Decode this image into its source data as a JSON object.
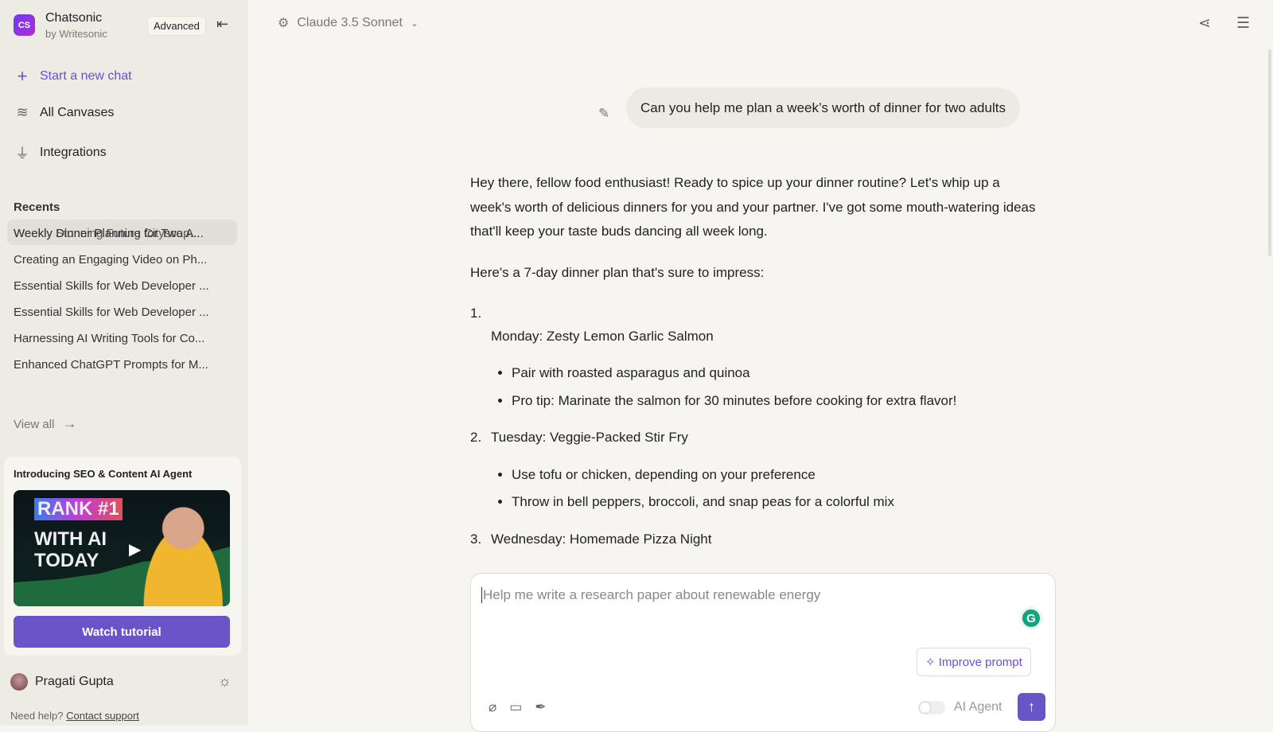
{
  "sidebar": {
    "brand": "Chatsonic",
    "brand_sub": "by Writesonic",
    "logo_text": "CS",
    "plan_badge": "Advanced",
    "nav": [
      {
        "label": "Start a new chat",
        "icon": "plus-icon"
      },
      {
        "label": "All Canvases",
        "icon": "layers-icon"
      },
      {
        "label": "Integrations",
        "icon": "plug-icon"
      }
    ],
    "recents_heading": "Recents",
    "recents": [
      "Weekly Dinner Planning for Two A...",
      "Weekly Stunning Future Cityscap...",
      "Creating an Engaging Video on Ph...",
      "Essential Skills for Web Developer ...",
      "Essential Skills for Web Developer ...",
      "Harnessing AI Writing Tools for Co...",
      "Enhanced ChatGPT Prompts for M..."
    ],
    "view_all": "View all",
    "promo": {
      "title": "Introducing SEO & Content AI Agent",
      "thumb_line1": "RANK #1",
      "thumb_line2": "WITH AI",
      "thumb_line3": "TODAY",
      "button": "Watch tutorial"
    },
    "user": "Pragati Gupta",
    "help": "Need help?",
    "help_link": "Contact support"
  },
  "header": {
    "model": "Claude 3.5 Sonnet"
  },
  "chat": {
    "user_message": "Can you help me plan a week’s worth of dinner for two adults",
    "intro": "Hey there, fellow food enthusiast! Ready to spice up your dinner routine? Let's whip up a week's worth of delicious dinners for you and your partner. I've got some mouth-watering ideas that'll keep your taste buds dancing all week long.",
    "lead": "Here's a 7-day dinner plan that's sure to impress:",
    "days": [
      {
        "num": "1.",
        "title": "Monday: Zesty Lemon Garlic Salmon",
        "bullets": [
          "Pair with roasted asparagus and quinoa",
          "Pro tip: Marinate the salmon for 30 minutes before cooking for extra flavor!"
        ]
      },
      {
        "num": "2.",
        "title": "Tuesday: Veggie-Packed Stir Fry",
        "bullets": [
          "Use tofu or chicken, depending on your preference",
          "Throw in bell peppers, broccoli, and snap peas for a colorful mix"
        ]
      },
      {
        "num": "3.",
        "title": "Wednesday: Homemade Pizza Night"
      }
    ]
  },
  "composer": {
    "placeholder": "Help me write a research paper about renewable energy",
    "improve": "Improve prompt",
    "agent_label": "AI Agent",
    "agent_enabled": false
  },
  "colors": {
    "accent": "#6a55c8",
    "sidebar_bg": "#ecebe4",
    "main_bg": "#f6f5f0"
  }
}
